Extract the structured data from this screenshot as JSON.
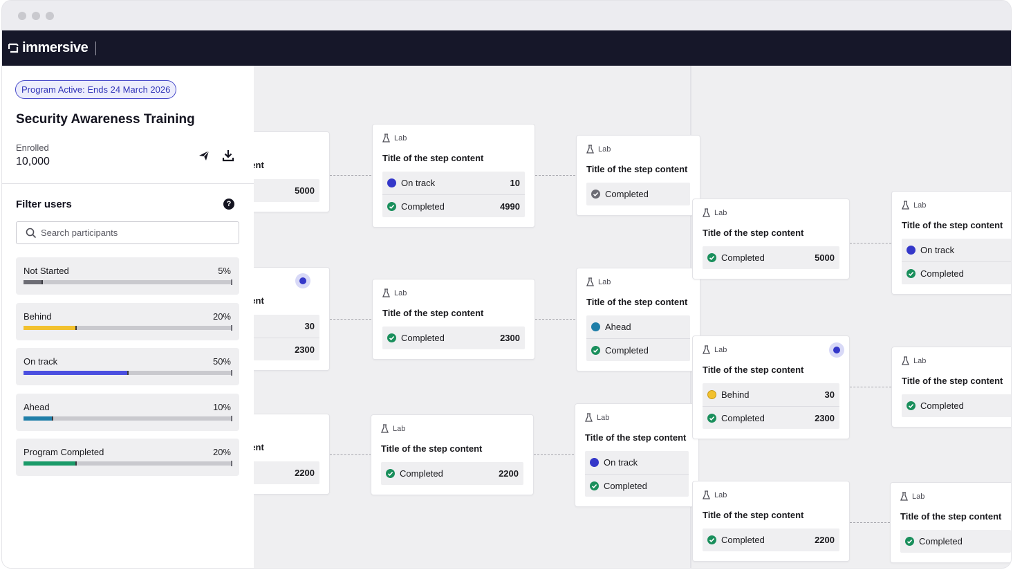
{
  "app": {
    "brand": "immersive"
  },
  "colors": {
    "on_track": "#3437c9",
    "completed": "#1a8f5c",
    "behind": "#f2c12e",
    "ahead": "#1f7ea8",
    "not_started": "#6c6c74",
    "completed_grey": "#6c6c74"
  },
  "sidebar": {
    "badge": "Program Active: Ends 24 March 2026",
    "title": "Security Awareness Training",
    "enrolled_label": "Enrolled",
    "enrolled_value": "10,000",
    "send_icon": "paper-plane-icon",
    "download_icon": "download-icon",
    "filter_title": "Filter users",
    "help_glyph": "?",
    "search": {
      "placeholder": "Search participants",
      "value": ""
    },
    "filters": [
      {
        "label": "Not Started",
        "percent": "5%",
        "fraction": 0.09,
        "color": "#6c6c74"
      },
      {
        "label": "Behind",
        "percent": "20%",
        "fraction": 0.25,
        "color": "#f2c12e"
      },
      {
        "label": "On track",
        "percent": "50%",
        "fraction": 0.5,
        "color": "#4b4fe0"
      },
      {
        "label": "Ahead",
        "percent": "10%",
        "fraction": 0.14,
        "color": "#1f7ea8"
      },
      {
        "label": "Program Completed",
        "percent": "20%",
        "fraction": 0.25,
        "color": "#1a9a68"
      }
    ]
  },
  "cards": [
    {
      "type": "",
      "title": "ntent",
      "rows": [
        {
          "status": "",
          "count": "5000"
        }
      ]
    },
    {
      "type": "",
      "title": "ntent",
      "rows": [
        {
          "status": "",
          "count": "30"
        },
        {
          "status": "",
          "count": "2300"
        }
      ]
    },
    {
      "type": "",
      "title": "ntent",
      "rows": [
        {
          "status": "",
          "count": "2200"
        }
      ]
    },
    {
      "type": "Lab",
      "title": "Title of the step content",
      "rows": [
        {
          "status": "On track",
          "count": "10"
        },
        {
          "status": "Completed",
          "count": "4990"
        }
      ]
    },
    {
      "type": "Lab",
      "title": "Title of the step content",
      "rows": [
        {
          "status": "Completed",
          "count": "2300"
        }
      ]
    },
    {
      "type": "Lab",
      "title": "Title of the step content",
      "rows": [
        {
          "status": "Completed",
          "count": "2200"
        }
      ]
    },
    {
      "type": "Lab",
      "title": "Title of the step content",
      "rows": [
        {
          "status": "Completed",
          "count": ""
        }
      ]
    },
    {
      "type": "Lab",
      "title": "Title of the step content",
      "rows": [
        {
          "status": "Ahead",
          "count": ""
        },
        {
          "status": "Completed",
          "count": ""
        }
      ]
    },
    {
      "type": "Lab",
      "title": "Title of the step content",
      "rows": [
        {
          "status": "On track",
          "count": ""
        },
        {
          "status": "Completed",
          "count": ""
        }
      ]
    },
    {
      "type": "Lab",
      "title": "Title of the step content",
      "rows": [
        {
          "status": "Completed",
          "count": "5000"
        }
      ]
    },
    {
      "type": "Lab",
      "title": "Title of the step content",
      "rows": [
        {
          "status": "Behind",
          "count": "30"
        },
        {
          "status": "Completed",
          "count": "2300"
        }
      ]
    },
    {
      "type": "Lab",
      "title": "Title of the step content",
      "rows": [
        {
          "status": "Completed",
          "count": "2200"
        }
      ]
    },
    {
      "type": "Lab",
      "title": "Title of the step content",
      "rows": [
        {
          "status": "On track",
          "count": ""
        },
        {
          "status": "Completed",
          "count": ""
        }
      ]
    },
    {
      "type": "Lab",
      "title": "Title of the step content",
      "rows": [
        {
          "status": "Completed",
          "count": ""
        }
      ]
    },
    {
      "type": "Lab",
      "title": "Title of the step content",
      "rows": [
        {
          "status": "Completed",
          "count": ""
        }
      ]
    }
  ]
}
